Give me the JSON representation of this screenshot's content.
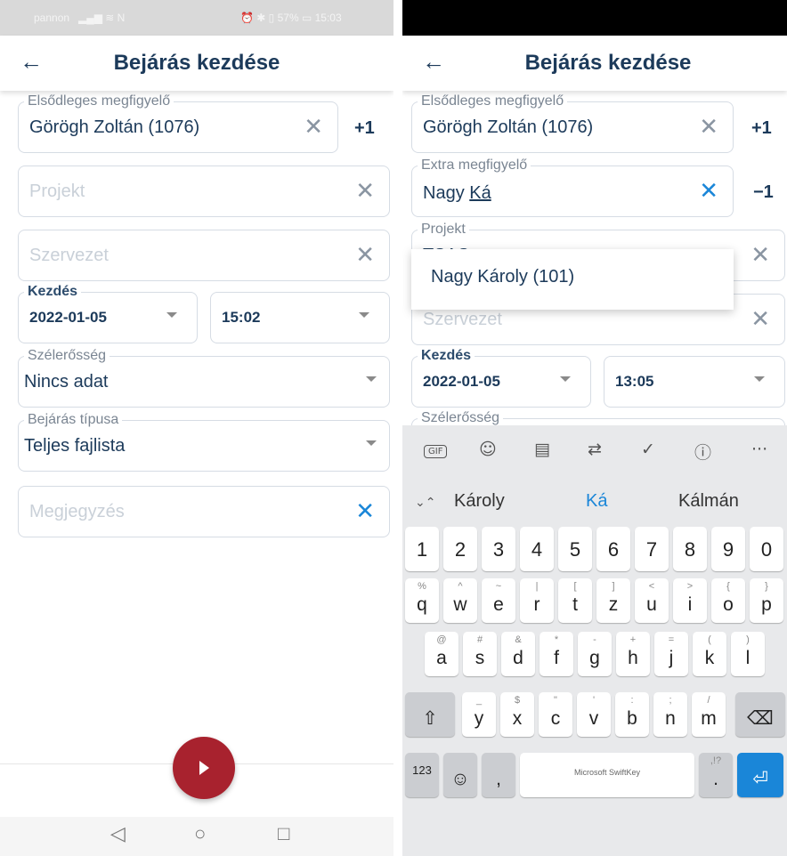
{
  "left": {
    "status": {
      "carrier": "pannon",
      "signal_icons": "▂▄▆ ≋ N",
      "right": "⏰ ✱ ▯ 57% ▭ 15:03"
    },
    "title": "Bejárás kezdése",
    "fields": {
      "primary_observer": {
        "label": "Elsődleges megfigyelő",
        "value": "Görögh Zoltán (1076)",
        "side": "+1"
      },
      "project": {
        "placeholder": "Projekt"
      },
      "organization": {
        "placeholder": "Szervezet"
      },
      "start": {
        "label": "Kezdés",
        "date": "2022-01-05",
        "time": "15:02"
      },
      "wind": {
        "label": "Szélerősség",
        "value": "Nincs adat"
      },
      "survey_type": {
        "label": "Bejárás típusa",
        "value": "Teljes fajlista"
      },
      "note": {
        "placeholder": "Megjegyzés"
      }
    }
  },
  "right": {
    "title": "Bejárás kezdése",
    "fields": {
      "primary_observer": {
        "label": "Elsődleges megfigyelő",
        "value": "Görögh Zoltán (1076)",
        "side": "+1"
      },
      "extra_observer": {
        "label": "Extra megfigyelő",
        "value_plain": "Nagy ",
        "value_underlined": "Ká",
        "side": "−1"
      },
      "project": {
        "label": "Projekt",
        "value": "TSAS"
      },
      "organization": {
        "placeholder": "Szervezet"
      },
      "start": {
        "label": "Kezdés",
        "date": "2022-01-05",
        "time": "13:05"
      },
      "wind": {
        "label": "Szélerősség"
      }
    },
    "dropdown_option": "Nagy Károly (101)",
    "keyboard": {
      "toolbar": [
        "GIF",
        "☺",
        "▤",
        "⇄",
        "✓",
        "ⓘ",
        "···"
      ],
      "suggestions": [
        "Károly",
        "Ká",
        "Kálmán"
      ],
      "collapse": "⌄⌃",
      "number_row": [
        "1",
        "2",
        "3",
        "4",
        "5",
        "6",
        "7",
        "8",
        "9",
        "0"
      ],
      "row1": [
        [
          "q",
          "%"
        ],
        [
          "w",
          "^"
        ],
        [
          "e",
          "~"
        ],
        [
          "r",
          "|"
        ],
        [
          "t",
          "["
        ],
        [
          "z",
          "]"
        ],
        [
          "u",
          "<"
        ],
        [
          "i",
          ">"
        ],
        [
          "o",
          "{"
        ],
        [
          "p",
          "}"
        ]
      ],
      "row2": [
        [
          "a",
          "@"
        ],
        [
          "s",
          "#"
        ],
        [
          "d",
          "&"
        ],
        [
          "f",
          "*"
        ],
        [
          "g",
          "-"
        ],
        [
          "h",
          "+"
        ],
        [
          "j",
          "="
        ],
        [
          "k",
          "("
        ],
        [
          "l",
          ")"
        ]
      ],
      "row3": [
        [
          "y",
          "_"
        ],
        [
          "x",
          "$"
        ],
        [
          "c",
          "\""
        ],
        [
          "v",
          "'"
        ],
        [
          "b",
          ":"
        ],
        [
          "n",
          ";"
        ],
        [
          "m",
          "/"
        ]
      ],
      "shift": "⇧",
      "backspace": "⌫",
      "symbols": "123",
      "emoji": "☺",
      "comma": ",",
      "space": "Microsoft SwiftKey",
      "period": ".",
      "period_sub": ",!?",
      "enter": "⏎"
    }
  }
}
